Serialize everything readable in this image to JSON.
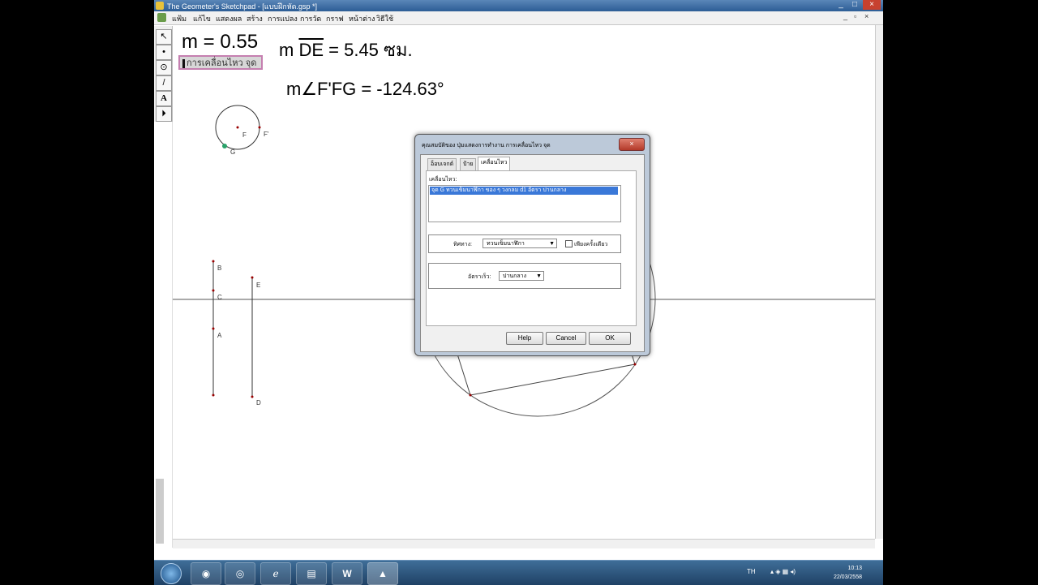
{
  "window": {
    "title": "The Geometer's Sketchpad - [แบบฝึกหัด.gsp *]",
    "controls": [
      "_",
      "□",
      "×"
    ],
    "mdi_controls": [
      "_",
      "▫",
      "×"
    ]
  },
  "menu": {
    "items": [
      "แฟ้ม",
      "แก้ไข",
      "แสดงผล",
      "สร้าง",
      "การแปลง",
      "การวัด",
      "กราฟ",
      "หน้าต่าง",
      "วิธีใช้"
    ]
  },
  "toolbox": {
    "tools": [
      "↖",
      "•",
      "⊙",
      "/",
      "A",
      "⏵"
    ]
  },
  "sketch": {
    "param_m": "m = 0.55",
    "measure_de_prefix": "m",
    "measure_de_seg": "DE",
    "measure_de_value": "= 5.45 ซม.",
    "angle_measure": "m∠F'FG = -124.63°",
    "motion_button": "การเคลื่อนไหว จุด",
    "points": [
      "F",
      "F'",
      "G",
      "B",
      "C",
      "A",
      "E",
      "D"
    ]
  },
  "dialog": {
    "title": "คุณสมบัติของ ปุ่มแสดงการทำงาน การเคลื่อนไหว จุด",
    "close": "×",
    "tabs": [
      "อ็อบเจกต์",
      "ป้าย",
      "เคลื่อนไหว"
    ],
    "active_tab": "เคลื่อนไหว",
    "list_label": "เคลื่อนไหว:",
    "list_selected": "จุด G ทวนเข็มนาฬิกา ของ ๆ วงกลม d1 อัตรา ปานกลาง",
    "direction_label": "ทิศทาง:",
    "direction_value": "ทวนเข็มนาฬิกา",
    "once_only_label": "เพียงครั้งเดียว",
    "speed_label": "อัตราเร็ว:",
    "speed_value": "ปานกลาง",
    "buttons": {
      "help": "Help",
      "cancel": "Cancel",
      "ok": "OK"
    }
  },
  "taskbar": {
    "apps": [
      "chrome",
      "firefox",
      "ie",
      "explorer",
      "word",
      "sketchpad"
    ],
    "tray_lang": "TH",
    "time": "10:13",
    "date": "22/03/2558"
  }
}
